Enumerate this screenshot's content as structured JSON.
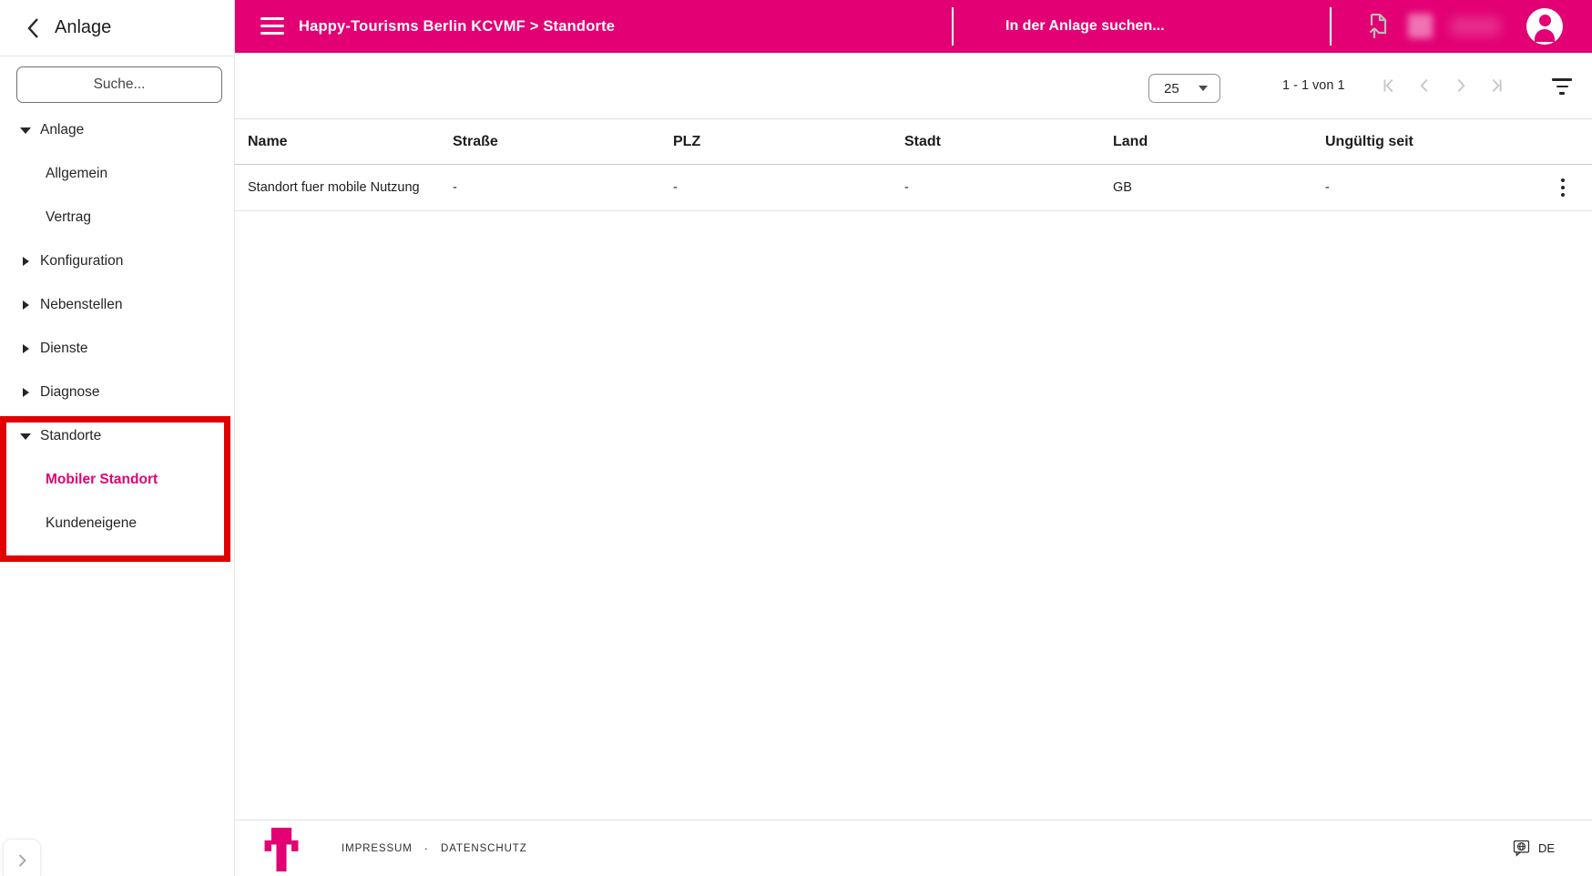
{
  "colors": {
    "brand_magenta": "#E20074",
    "annotation_red": "#E10000",
    "disabled_gray": "#C5C5C5"
  },
  "sidebar": {
    "back_icon": "chevron-left-icon",
    "back_label": "Anlage",
    "search_placeholder": "Suche...",
    "items": [
      {
        "label": "Anlage",
        "level": 0,
        "state": "expanded"
      },
      {
        "label": "Allgemein",
        "level": 1
      },
      {
        "label": "Vertrag",
        "level": 1
      },
      {
        "label": "Konfiguration",
        "level": 0,
        "state": "collapsed"
      },
      {
        "label": "Nebenstellen",
        "level": 0,
        "state": "collapsed"
      },
      {
        "label": "Dienste",
        "level": 0,
        "state": "collapsed"
      },
      {
        "label": "Diagnose",
        "level": 0,
        "state": "collapsed"
      },
      {
        "label": "Standorte",
        "level": 0,
        "state": "expanded"
      },
      {
        "label": "Mobiler Standort",
        "level": 1,
        "active": true
      },
      {
        "label": "Kundeneigene",
        "level": 1
      }
    ],
    "annotation": "red highlight box around Standorte section",
    "expand_button_icon": "chevron-right-icon"
  },
  "header": {
    "menu_icon": "hamburger-menu-icon",
    "breadcrumb": "Happy-Tourisms Berlin KCVMF > Standorte",
    "search_placeholder": "In der Anlage suchen...",
    "icons": [
      "file-upload-icon",
      "redacted-icon",
      "redacted-username",
      "user-avatar-icon"
    ]
  },
  "toolbar": {
    "page_size": "25",
    "page_size_caret": "caret-down-icon",
    "range_label": "1 - 1 von 1",
    "pagination_icons": [
      "first-page-icon",
      "chevron-left-icon",
      "chevron-right-icon",
      "last-page-icon"
    ],
    "filter_icon": "filter-list-icon"
  },
  "table": {
    "columns": [
      "Name",
      "Straße",
      "PLZ",
      "Stadt",
      "Land",
      "Ungültig seit"
    ],
    "rows": [
      {
        "cells": [
          "Standort fuer mobile Nutzung",
          "-",
          "-",
          "-",
          "GB",
          "-"
        ],
        "action_icon": "kebab-menu-icon"
      }
    ]
  },
  "footer": {
    "logo": "telekom-t-logo",
    "links": [
      "IMPRESSUM",
      "DATENSCHUTZ"
    ],
    "separator": "·",
    "language_icon": "language-bubble-icon",
    "language": "DE"
  }
}
